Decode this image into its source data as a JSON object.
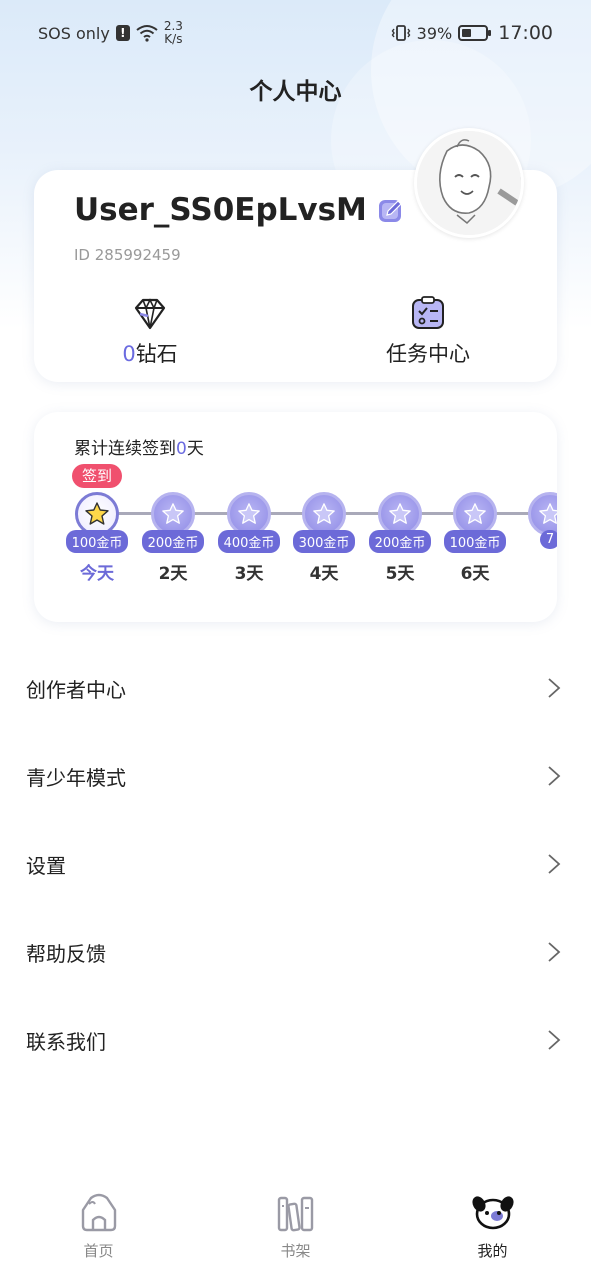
{
  "status_bar": {
    "carrier": "SOS only",
    "sim_badge": "!",
    "net_speed_value": "2.3",
    "net_speed_unit": "K/s",
    "battery_percent": "39%",
    "time": "17:00"
  },
  "header": {
    "title": "个人中心"
  },
  "profile": {
    "username": "User_SS0EpLvsM",
    "id_text": "ID 285992459",
    "diamonds_count": "0",
    "diamonds_label": "钻石",
    "task_center_label": "任务中心"
  },
  "signin": {
    "title_prefix": "累计连续签到",
    "days_count": "0",
    "title_suffix": "天",
    "badge_label": "签到",
    "days": [
      {
        "reward": "100金币",
        "label": "今天"
      },
      {
        "reward": "200金币",
        "label": "2天"
      },
      {
        "reward": "400金币",
        "label": "3天"
      },
      {
        "reward": "300金币",
        "label": "4天"
      },
      {
        "reward": "200金币",
        "label": "5天"
      },
      {
        "reward": "100金币",
        "label": "6天"
      },
      {
        "reward": "7",
        "label": ""
      }
    ]
  },
  "menu": {
    "items": [
      {
        "label": "创作者中心"
      },
      {
        "label": "青少年模式"
      },
      {
        "label": "设置"
      },
      {
        "label": "帮助反馈"
      },
      {
        "label": "联系我们"
      }
    ]
  },
  "bottom_nav": {
    "items": [
      {
        "label": "首页",
        "icon": "home-icon"
      },
      {
        "label": "书架",
        "icon": "bookshelf-icon"
      },
      {
        "label": "我的",
        "icon": "mine-icon"
      }
    ],
    "active_index": 2
  },
  "colors": {
    "accent": "#6c6ad8",
    "badge_red": "#f0506e"
  }
}
